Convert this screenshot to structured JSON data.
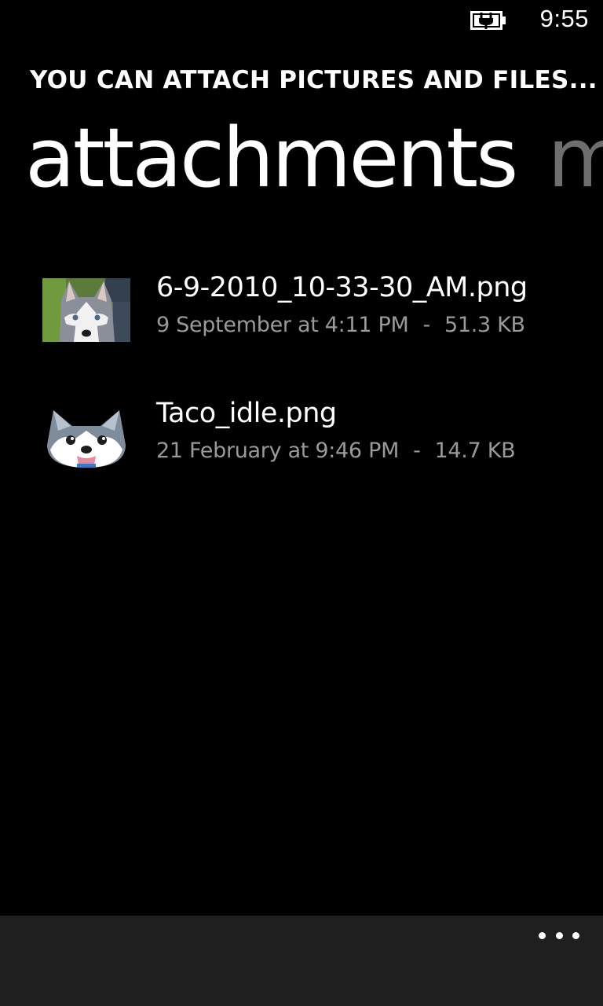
{
  "status_bar": {
    "time": "9:55",
    "battery_icon": "battery-charging-icon"
  },
  "header": {
    "app_title": "YOU CAN ATTACH PICTURES AND FILES...",
    "pivot_items": [
      {
        "label": "attachments",
        "active": true
      },
      {
        "label": "m",
        "active": false
      }
    ]
  },
  "attachments": [
    {
      "file_name": "6-9-2010_10-33-30_AM.png",
      "date": "9 September at 4:11 PM",
      "separator": "-",
      "size": "51.3 KB",
      "thumbnail": "husky-photo-thumbnail"
    },
    {
      "file_name": "Taco_idle.png",
      "date": "21 February at 9:46 PM",
      "separator": "-",
      "size": "14.7 KB",
      "thumbnail": "husky-cartoon-thumbnail"
    }
  ],
  "app_bar": {
    "more_icon": "ellipsis-icon"
  },
  "colors": {
    "background": "#000000",
    "text_primary": "#ffffff",
    "text_secondary": "#9a9a9a",
    "pivot_inactive": "#6e6e6e",
    "app_bar": "#1f1f1f"
  }
}
